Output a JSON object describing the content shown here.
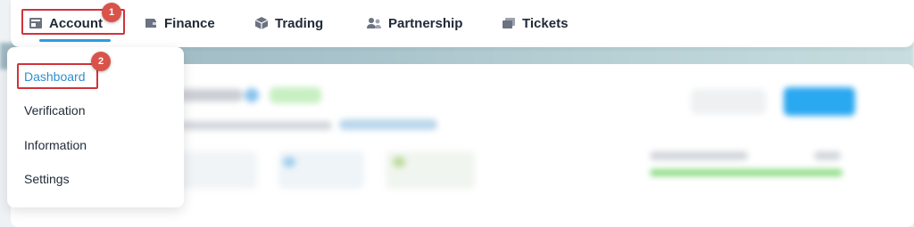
{
  "nav": {
    "items": [
      {
        "label": "Account",
        "icon": "account-icon",
        "active": true
      },
      {
        "label": "Finance",
        "icon": "wallet-icon",
        "active": false
      },
      {
        "label": "Trading",
        "icon": "box-icon",
        "active": false
      },
      {
        "label": "Partnership",
        "icon": "people-icon",
        "active": false
      },
      {
        "label": "Tickets",
        "icon": "tickets-icon",
        "active": false
      }
    ]
  },
  "dropdown": {
    "items": [
      {
        "label": "Dashboard",
        "selected": true
      },
      {
        "label": "Verification",
        "selected": false
      },
      {
        "label": "Information",
        "selected": false
      },
      {
        "label": "Settings",
        "selected": false
      }
    ]
  },
  "annotations": {
    "step1": "1",
    "step2": "2"
  },
  "colors": {
    "accent": "#2d9de0",
    "highlight": "#d2333b",
    "badge": "#d9534a",
    "text": "#1f2a37"
  }
}
